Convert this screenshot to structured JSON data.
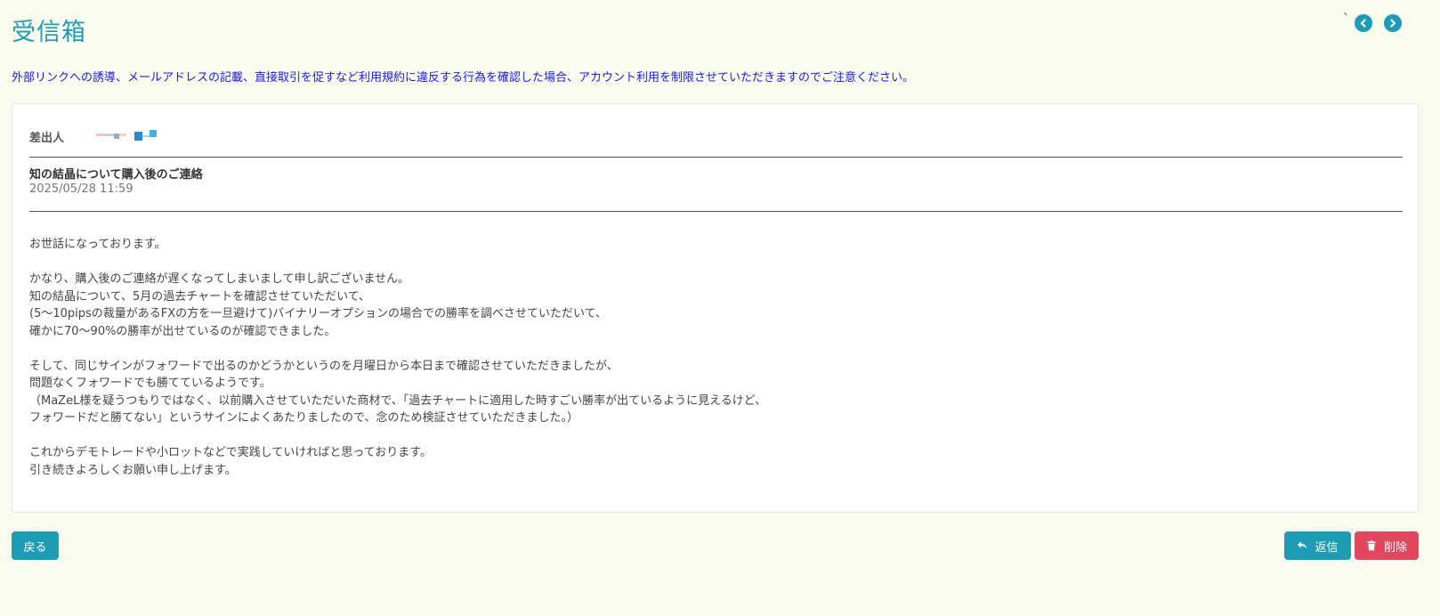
{
  "header": {
    "title": "受信箱",
    "nav_tick": "`",
    "prev_icon": "chevron-left-circle-icon",
    "next_icon": "chevron-right-circle-icon"
  },
  "notice": "外部リンクへの誘導、メールアドレスの記載、直接取引を促すなど利用規約に違反する行為を確認した場合、アカウント利用を制限させていただきますのでご注意ください。",
  "message": {
    "sender_label": "差出人",
    "subject": "知の結晶について購入後のご連絡",
    "date": "2025/05/28 11:59",
    "body_lines": [
      "お世話になっております。",
      "",
      "かなり、購入後のご連絡が遅くなってしまいまして申し訳ございません。",
      "知の結晶について、5月の過去チャートを確認させていただいて、",
      "(5～10pipsの裁量があるFXの方を一旦避けて)バイナリーオプションの場合での勝率を調べさせていただいて、",
      "確かに70～90%の勝率が出せているのが確認できました。",
      "",
      "そして、同じサインがフォワードで出るのかどうかというのを月曜日から本日まで確認させていただきましたが、",
      "問題なくフォワードでも勝てているようです。",
      "（MaZeL様を疑うつもりではなく、以前購入させていただいた商材で、「過去チャートに適用した時すごい勝率が出ているように見えるけど、",
      "フォワードだと勝てない」というサインによくあたりましたので、念のため検証させていただきました。）",
      "",
      "これからデモトレードや小ロットなどで実践していければと思っております。",
      "引き続きよろしくお願い申し上げます。"
    ]
  },
  "buttons": {
    "back": "戻る",
    "reply": "返信",
    "reply_icon": "reply-icon",
    "delete": "削除",
    "delete_icon": "trash-icon"
  },
  "colors": {
    "accent": "#1e9bb5",
    "danger": "#e2475f",
    "notice": "#1a1aee",
    "background": "#f9fbef"
  }
}
